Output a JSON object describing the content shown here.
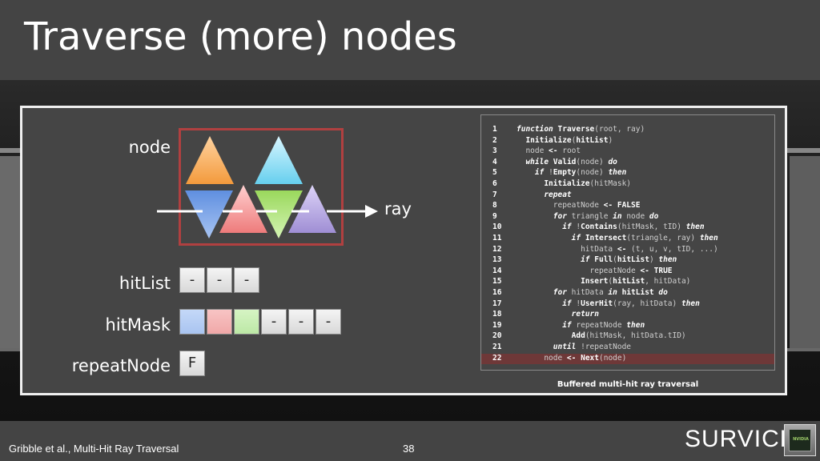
{
  "slide": {
    "title": "Traverse (more) nodes",
    "footer_left": "Gribble et al., Multi-Hit Ray Traversal",
    "page_number": "38",
    "logo_text": "SURVICE",
    "logo_badge_text": "NVIDIA"
  },
  "diagram": {
    "node_label": "node",
    "ray_label": "ray",
    "hitlist_label": "hitList",
    "hitmask_label": "hitMask",
    "repeatnode_label": "repeatNode",
    "hitlist_cells": [
      "-",
      "-",
      "-"
    ],
    "hitmask_cells": [
      "",
      "",
      "",
      "-",
      "-",
      "-"
    ],
    "repeatnode_value": "F",
    "colors": {
      "orange": "#f7a550",
      "cyan": "#7fd9f0",
      "blue": "#6d9be8",
      "red": "#f08a8a",
      "green": "#a8e070",
      "purple": "#a99ad8",
      "node_box": "#b04040"
    }
  },
  "code": {
    "caption": "Buffered multi-hit ray traversal",
    "highlighted_line": "22",
    "lines": [
      {
        "n": "1",
        "t": "function Traverse(root, ray)"
      },
      {
        "n": "2",
        "t": "  Initialize(hitList)"
      },
      {
        "n": "3",
        "t": "  node <- root"
      },
      {
        "n": "4",
        "t": "  while Valid(node) do"
      },
      {
        "n": "5",
        "t": "    if !Empty(node) then"
      },
      {
        "n": "6",
        "t": "      Initialize(hitMask)"
      },
      {
        "n": "7",
        "t": "      repeat"
      },
      {
        "n": "8",
        "t": "        repeatNode <- FALSE"
      },
      {
        "n": "9",
        "t": "        for triangle in node do"
      },
      {
        "n": "10",
        "t": "          if !Contains(hitMask, tID) then"
      },
      {
        "n": "11",
        "t": "            if Intersect(triangle, ray) then"
      },
      {
        "n": "12",
        "t": "              hitData <- (t, u, v, tID, ...)"
      },
      {
        "n": "13",
        "t": "              if Full(hitList) then"
      },
      {
        "n": "14",
        "t": "                repeatNode <- TRUE"
      },
      {
        "n": "15",
        "t": "              Insert(hitList, hitData)"
      },
      {
        "n": "16",
        "t": "        for hitData in hitList do"
      },
      {
        "n": "17",
        "t": "          if !UserHit(ray, hitData) then"
      },
      {
        "n": "18",
        "t": "            return"
      },
      {
        "n": "19",
        "t": "          if repeatNode then"
      },
      {
        "n": "20",
        "t": "            Add(hitMask, hitData.tID)"
      },
      {
        "n": "21",
        "t": "        until !repeatNode"
      },
      {
        "n": "22",
        "t": "      node <- Next(node)"
      }
    ]
  }
}
